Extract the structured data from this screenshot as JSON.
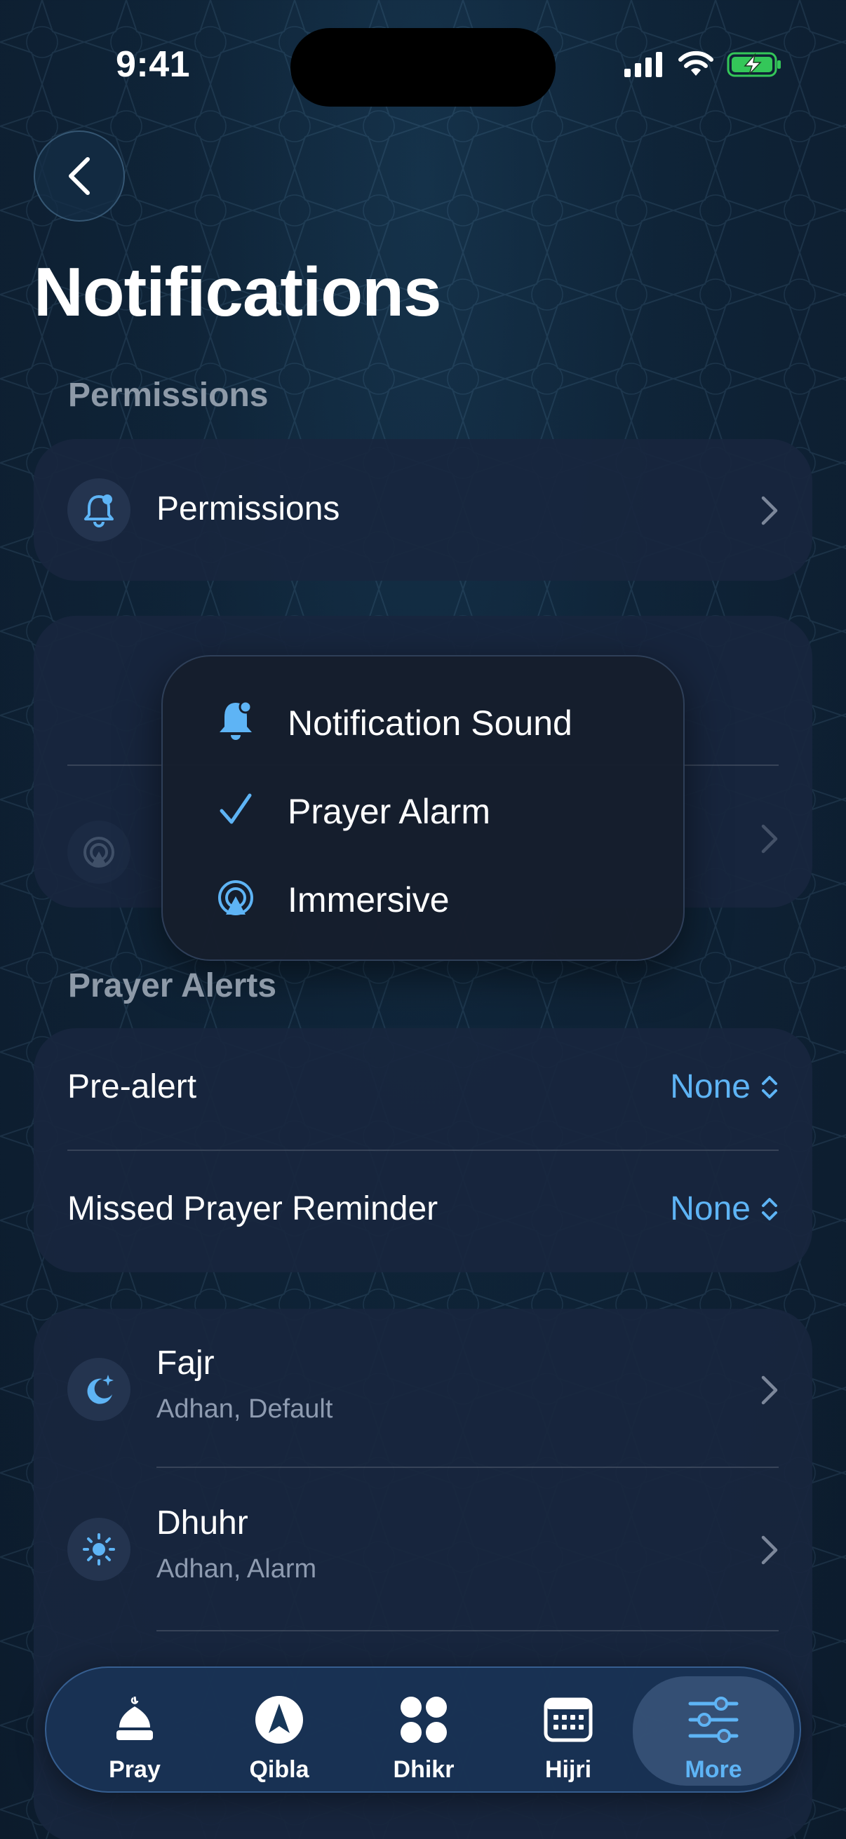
{
  "status": {
    "time": "9:41"
  },
  "header": {
    "title": "Notifications"
  },
  "permissions_section": {
    "header": "Permissions",
    "row_label": "Permissions"
  },
  "context_menu": {
    "items": [
      {
        "label": "Notification Sound",
        "icon": "bell-icon"
      },
      {
        "label": "Prayer Alarm",
        "icon": "checkmark-icon",
        "selected": true
      },
      {
        "label": "Immersive",
        "icon": "broadcast-icon"
      }
    ]
  },
  "prayer_alerts": {
    "header": "Prayer Alerts",
    "pre_alert": {
      "label": "Pre-alert",
      "value": "None"
    },
    "missed_reminder": {
      "label": "Missed Prayer Reminder",
      "value": "None"
    }
  },
  "prayers": [
    {
      "name": "Fajr",
      "detail": "Adhan, Default",
      "icon": "moon-stars-icon"
    },
    {
      "name": "Dhuhr",
      "detail": "Adhan, Alarm",
      "icon": "sun-icon"
    }
  ],
  "tabs": [
    {
      "label": "Pray",
      "icon": "mosque-icon"
    },
    {
      "label": "Qibla",
      "icon": "compass-icon"
    },
    {
      "label": "Dhikr",
      "icon": "dots-grid-icon"
    },
    {
      "label": "Hijri",
      "icon": "calendar-icon"
    },
    {
      "label": "More",
      "icon": "sliders-icon",
      "active": true
    }
  ],
  "colors": {
    "accent": "#5eb4f5",
    "card": "#182640",
    "background": "#0f2438"
  }
}
